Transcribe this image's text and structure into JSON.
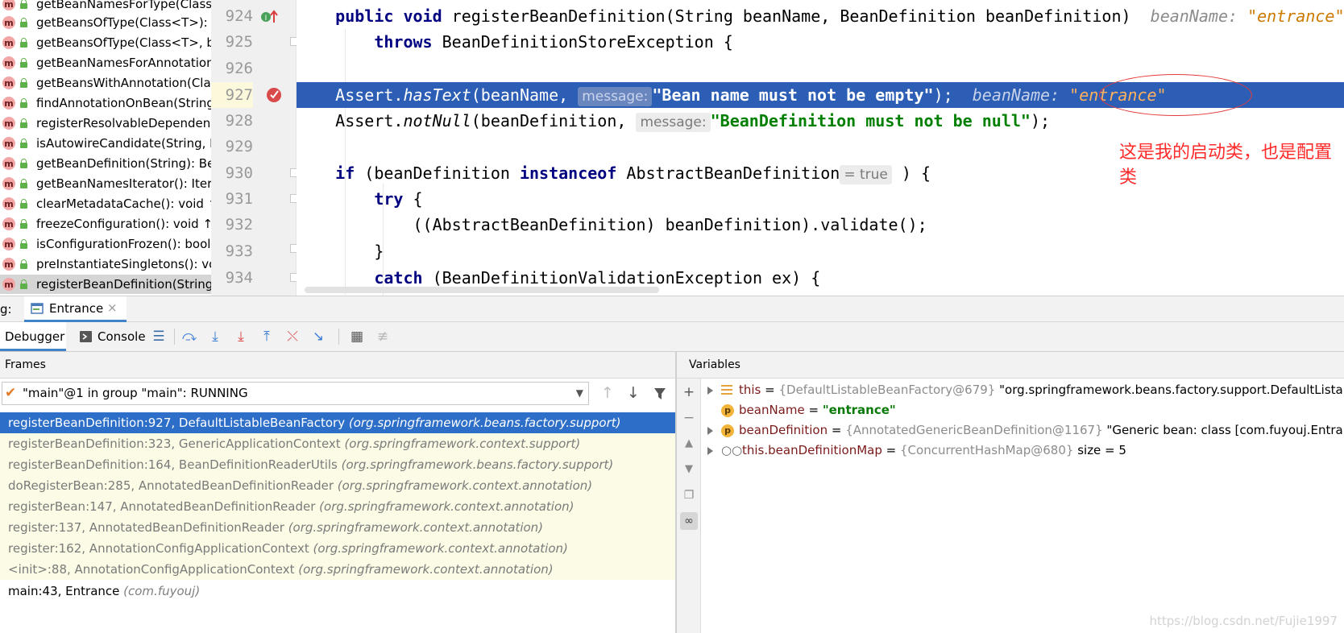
{
  "structure": {
    "items": [
      {
        "label": "getBeanNamesForType(Class<"
      },
      {
        "label": "getBeansOfType(Class<T>): M"
      },
      {
        "label": "getBeansOfType(Class<T>, bo"
      },
      {
        "label": "getBeanNamesForAnnotation"
      },
      {
        "label": "getBeansWithAnnotation(Clas"
      },
      {
        "label": "findAnnotationOnBean(String,"
      },
      {
        "label": "registerResolvableDependenc"
      },
      {
        "label": "isAutowireCandidate(String, D"
      },
      {
        "label": "getBeanDefinition(String): Bea"
      },
      {
        "label": "getBeanNamesIterator(): Itera"
      },
      {
        "label": "clearMetadataCache(): void ↑A"
      },
      {
        "label": "freezeConfiguration(): void ↑C"
      },
      {
        "label": "isConfigurationFrozen(): boole"
      },
      {
        "label": "preInstantiateSingletons(): voi"
      },
      {
        "label": "registerBeanDefinition(String,"
      }
    ],
    "method_icon": "m"
  },
  "editor": {
    "line_numbers": [
      "924",
      "925",
      "926",
      "927",
      "928",
      "929",
      "930",
      "931",
      "932",
      "933",
      "934"
    ],
    "line924": {
      "indent": "    ",
      "kw1": "public",
      "kw2": "void",
      "sig": " registerBeanDefinition(String beanName, BeanDefinition beanDefinition)",
      "hint_label": "beanName: ",
      "hint_value": "\"entrance\""
    },
    "line925": {
      "indent": "        ",
      "kw": "throws",
      "rest": " BeanDefinitionStoreException {"
    },
    "line927": {
      "indent": "    ",
      "cls": "Assert.",
      "method": "hasText",
      "open": "(beanName, ",
      "param_hint": "message:",
      "str": "\"Bean name must not be empty\"",
      "close": ");",
      "hint_label": "beanName: ",
      "hint_value": "\"entrance\""
    },
    "line928": {
      "indent": "    ",
      "cls": "Assert.",
      "method": "notNull",
      "open": "(beanDefinition, ",
      "param_hint": "message:",
      "str": "\"BeanDefinition must not be null\"",
      "close": ");"
    },
    "line930": {
      "indent": "    ",
      "kw1": "if",
      "mid": " (beanDefinition ",
      "kw2": "instanceof",
      "rest": " AbstractBeanDefinition",
      "eval_hint": "= true",
      "close": " ) {"
    },
    "line931": {
      "indent": "        ",
      "kw": "try",
      "rest": " {"
    },
    "line932": {
      "indent": "            ",
      "text": "((AbstractBeanDefinition) beanDefinition).validate();"
    },
    "line933": {
      "indent": "        ",
      "text": "}"
    },
    "line934": {
      "indent": "        ",
      "kw": "catch",
      "rest": " (BeanDefinitionValidationException ex) {"
    }
  },
  "annotation": {
    "text": "这是我的启动类，也是配置类",
    "color": "#ff2a2a"
  },
  "debug": {
    "tool_label": "g:",
    "session_tab": "Entrance",
    "tabs": {
      "debugger": "Debugger",
      "console": "Console"
    },
    "frames_label": "Frames",
    "variables_label": "Variables",
    "thread": "\"main\"@1 in group \"main\": RUNNING",
    "frames": [
      {
        "method": "registerBeanDefinition:927, DefaultListableBeanFactory",
        "pkg": "(org.springframework.beans.factory.support)"
      },
      {
        "method": "registerBeanDefinition:323, GenericApplicationContext",
        "pkg": "(org.springframework.context.support)"
      },
      {
        "method": "registerBeanDefinition:164, BeanDefinitionReaderUtils",
        "pkg": "(org.springframework.beans.factory.support)"
      },
      {
        "method": "doRegisterBean:285, AnnotatedBeanDefinitionReader",
        "pkg": "(org.springframework.context.annotation)"
      },
      {
        "method": "registerBean:147, AnnotatedBeanDefinitionReader",
        "pkg": "(org.springframework.context.annotation)"
      },
      {
        "method": "register:137, AnnotatedBeanDefinitionReader",
        "pkg": "(org.springframework.context.annotation)"
      },
      {
        "method": "register:162, AnnotationConfigApplicationContext",
        "pkg": "(org.springframework.context.annotation)"
      },
      {
        "method": "<init>:88, AnnotationConfigApplicationContext",
        "pkg": "(org.springframework.context.annotation)"
      },
      {
        "method": "main:43, Entrance",
        "pkg": "(com.fuyouj)"
      }
    ],
    "variables": [
      {
        "name": "this",
        "eq": " = ",
        "ref": "{DefaultListableBeanFactory@679}",
        "value": " \"org.springframework.beans.factory.support.DefaultListableBe",
        "icon": "field-lines-icon"
      },
      {
        "name": "beanName",
        "eq": " = ",
        "ref": "",
        "value": "\"entrance\"",
        "icon": "p"
      },
      {
        "name": "beanDefinition",
        "eq": " = ",
        "ref": "{AnnotatedGenericBeanDefinition@1167}",
        "value": " \"Generic bean: class [com.fuyouj.Entrance]; s",
        "icon": "p"
      },
      {
        "name": "this.beanDefinitionMap",
        "eq": " = ",
        "ref": "{ConcurrentHashMap@680}",
        "value": " size = 5",
        "icon": "watch-glasses-icon"
      }
    ]
  },
  "watermark": "https://blog.csdn.net/Fujie1997"
}
